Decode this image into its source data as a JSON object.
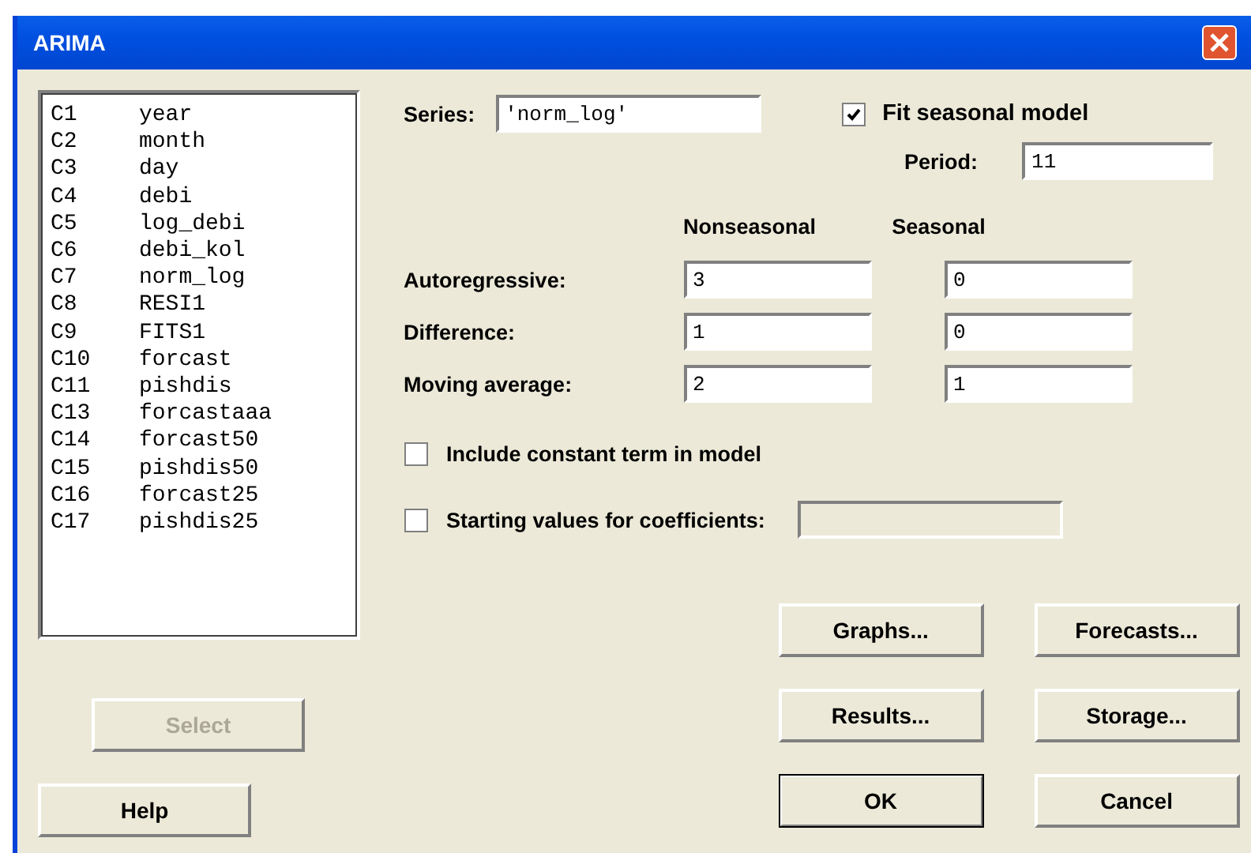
{
  "window": {
    "title": "ARIMA"
  },
  "columns_list": [
    {
      "id": "C1",
      "name": "year"
    },
    {
      "id": "C2",
      "name": "month"
    },
    {
      "id": "C3",
      "name": "day"
    },
    {
      "id": "C4",
      "name": "debi"
    },
    {
      "id": "C5",
      "name": "log_debi"
    },
    {
      "id": "C6",
      "name": "debi_kol"
    },
    {
      "id": "C7",
      "name": "norm_log"
    },
    {
      "id": "C8",
      "name": "RESI1"
    },
    {
      "id": "C9",
      "name": "FITS1"
    },
    {
      "id": "C10",
      "name": "forcast"
    },
    {
      "id": "C11",
      "name": "pishdis"
    },
    {
      "id": "C13",
      "name": "forcastaaa"
    },
    {
      "id": "C14",
      "name": "forcast50"
    },
    {
      "id": "C15",
      "name": "pishdis50"
    },
    {
      "id": "C16",
      "name": "forcast25"
    },
    {
      "id": "C17",
      "name": "pishdis25"
    }
  ],
  "series": {
    "label": "Series:",
    "value": "'norm_log'"
  },
  "fit_seasonal": {
    "label": "Fit seasonal model",
    "checked": true
  },
  "period": {
    "label": "Period:",
    "value": "11"
  },
  "headers": [
    "Nonseasonal",
    "Seasonal"
  ],
  "rows": [
    {
      "label": "Autoregressive:",
      "nonseasonal": "3",
      "seasonal": "0"
    },
    {
      "label": "Difference:",
      "nonseasonal": "1",
      "seasonal": "0"
    },
    {
      "label": "Moving average:",
      "nonseasonal": "2",
      "seasonal": "1"
    }
  ],
  "include_constant": {
    "label": "Include constant term in model",
    "checked": false
  },
  "starting_values": {
    "label": "Starting values for coefficients:",
    "checked": false,
    "field_disabled": true
  },
  "select_button": {
    "label": "Select",
    "disabled": true
  },
  "help_button": {
    "label": "Help",
    "disabled": false
  },
  "buttons": [
    {
      "label": "Graphs...",
      "default": false
    },
    {
      "label": "Forecasts...",
      "default": false
    },
    {
      "label": "Results...",
      "default": false
    },
    {
      "label": "Storage...",
      "default": false
    },
    {
      "label": "OK",
      "default": true
    },
    {
      "label": "Cancel",
      "default": false
    }
  ]
}
